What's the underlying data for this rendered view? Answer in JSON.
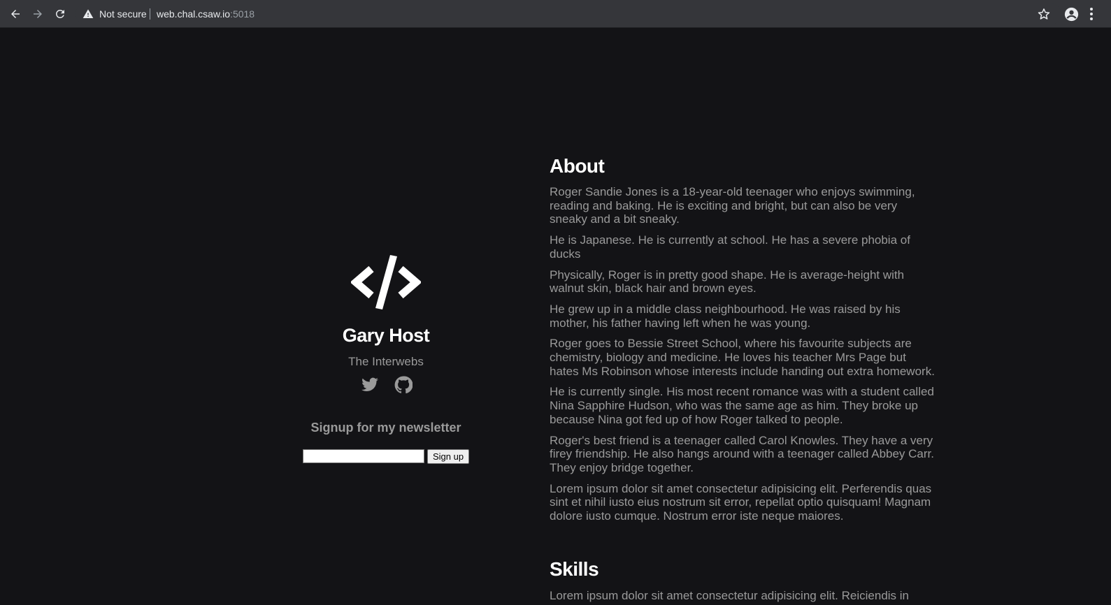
{
  "browser": {
    "security_label": "Not secure",
    "url_host": "web.chal.csaw.io",
    "url_port": ":5018"
  },
  "profile": {
    "name": "Gary Host",
    "tagline": "The Interwebs",
    "socials": [
      "twitter-icon",
      "github-icon"
    ],
    "newsletter_heading": "Signup for my newsletter",
    "signup_input_value": "",
    "signup_button_label": "Sign up"
  },
  "about": {
    "heading": "About",
    "paragraphs": [
      "Roger Sandie Jones is a 18-year-old teenager who enjoys swimming, reading and baking. He is exciting and bright, but can also be very sneaky and a bit sneaky.",
      "He is Japanese. He is currently at school. He has a severe phobia of ducks",
      "Physically, Roger is in pretty good shape. He is average-height with walnut skin, black hair and brown eyes.",
      "He grew up in a middle class neighbourhood. He was raised by his mother, his father having left when he was young.",
      "Roger goes to Bessie Street School, where his favourite subjects are chemistry, biology and medicine. He loves his teacher Mrs Page but hates Ms Robinson whose interests include handing out extra homework.",
      "He is currently single. His most recent romance was with a student called Nina Sapphire Hudson, who was the same age as him. They broke up because Nina got fed up of how Roger talked to people.",
      "Roger's best friend is a teenager called Carol Knowles. They have a very firey friendship. He also hangs around with a teenager called Abbey Carr. They enjoy bridge together.",
      "Lorem ipsum dolor sit amet consectetur adipisicing elit. Perferendis quas sint et nihil iusto eius nostrum sit error, repellat optio quisquam! Magnam dolore iusto cumque. Nostrum error iste neque maiores."
    ]
  },
  "skills": {
    "heading": "Skills",
    "text": "Lorem ipsum dolor sit amet consectetur adipisicing elit. Reiciendis in"
  },
  "colors": {
    "background": "#131316",
    "heading": "#ffffff",
    "body_text": "#9a9a9a",
    "chrome": "#35363a"
  }
}
